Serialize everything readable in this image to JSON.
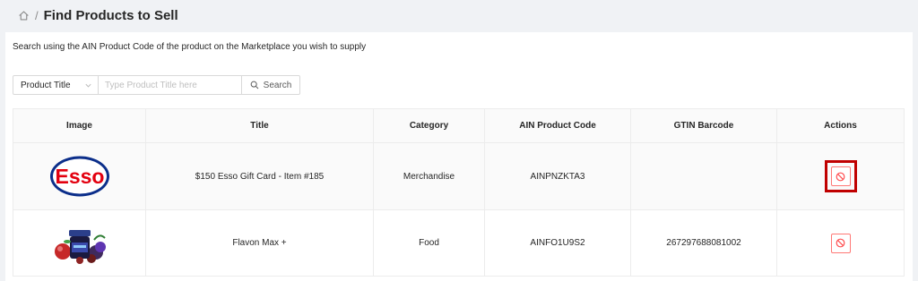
{
  "breadcrumb": {
    "separator": "/",
    "title": "Find Products to Sell"
  },
  "description": "Search using the AIN Product Code of the product on the Marketplace you wish to supply",
  "search": {
    "field_selected": "Product Title",
    "placeholder": "Type Product Title here",
    "value": "",
    "button_label": "Search"
  },
  "table": {
    "columns": [
      "Image",
      "Title",
      "Category",
      "AIN Product Code",
      "GTIN Barcode",
      "Actions"
    ],
    "rows": [
      {
        "image": "esso-logo",
        "logo_text": "Esso",
        "title": "$150 Esso Gift Card - Item #185",
        "category": "Merchandise",
        "ain": "AINPNZKTA3",
        "gtin": "",
        "action_icon": "ban-icon"
      },
      {
        "image": "flavon-product",
        "title": "Flavon Max +",
        "category": "Food",
        "ain": "AINFO1U9S2",
        "gtin": "267297688081002",
        "action_icon": "ban-icon"
      }
    ]
  },
  "colors": {
    "highlight": "#c00000",
    "danger": "#ff4d4f",
    "esso_red": "#e3000f",
    "esso_blue": "#0b2e8a"
  }
}
